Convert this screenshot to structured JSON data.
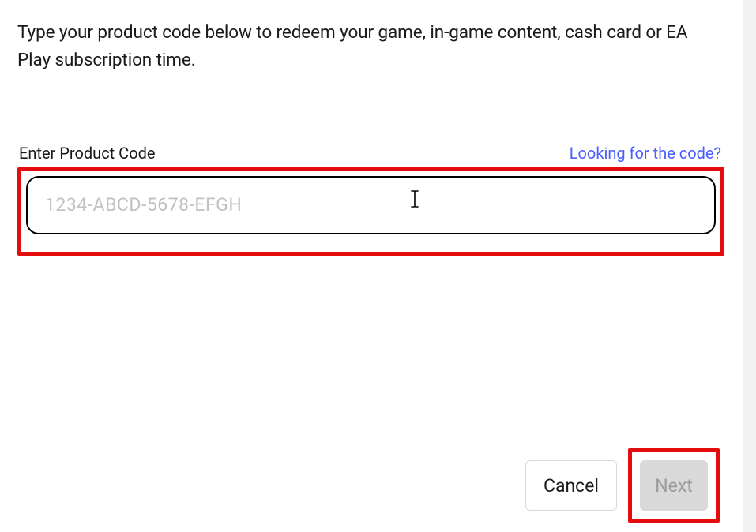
{
  "description": "Type your product code below to redeem your game, in-game content, cash card or EA Play subscription time.",
  "field": {
    "label": "Enter Product Code",
    "help_link": "Looking for the code?",
    "placeholder": "1234-ABCD-5678-EFGH",
    "value": ""
  },
  "buttons": {
    "cancel": "Cancel",
    "next": "Next"
  }
}
